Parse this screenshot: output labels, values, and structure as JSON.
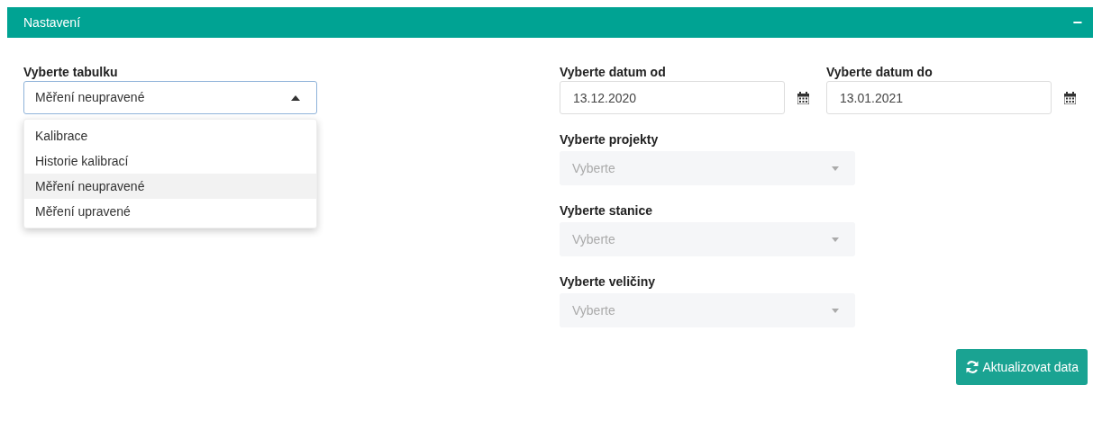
{
  "panel": {
    "title": "Nastavení",
    "collapse_icon": "−"
  },
  "table_select": {
    "label": "Vyberte tabulku",
    "value": "Měření neupravené",
    "expanded": true,
    "options": [
      {
        "label": "Kalibrace",
        "selected": false
      },
      {
        "label": "Historie kalibrací",
        "selected": false
      },
      {
        "label": "Měření neupravené",
        "selected": true
      },
      {
        "label": "Měření upravené",
        "selected": false
      }
    ]
  },
  "dates": [
    {
      "label": "Vyberte datum od",
      "value": "13.12.2020"
    },
    {
      "label": "Vyberte datum do",
      "value": "13.01.2021"
    }
  ],
  "selects": [
    {
      "label": "Vyberte projekty",
      "placeholder": "Vyberte",
      "disabled": true
    },
    {
      "label": "Vyberte stanice",
      "placeholder": "Vyberte",
      "disabled": true
    },
    {
      "label": "Vyberte veličiny",
      "placeholder": "Vyberte",
      "disabled": true
    }
  ],
  "button": {
    "label": "Aktualizovat data"
  }
}
